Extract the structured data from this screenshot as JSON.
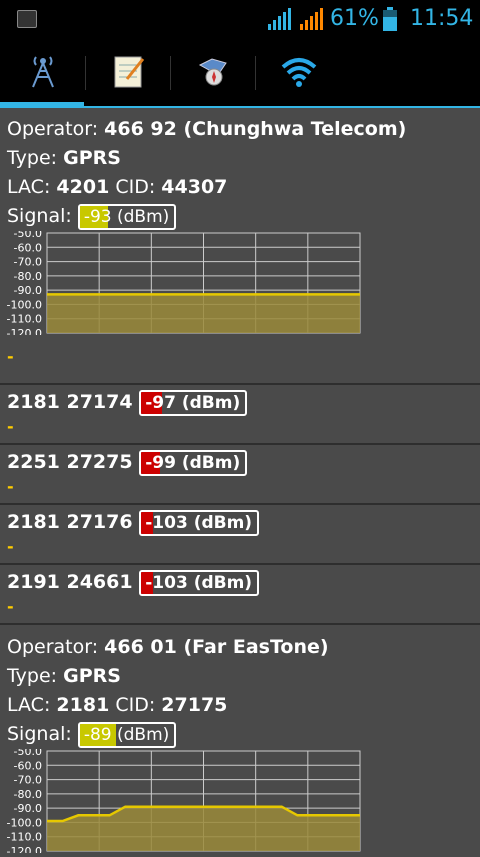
{
  "status": {
    "battery": "61%",
    "time": "11:54"
  },
  "tabs": [
    {
      "name": "tab-cell-towers",
      "icon": "antenna-tower-icon"
    },
    {
      "name": "tab-log",
      "icon": "notepad-icon"
    },
    {
      "name": "tab-map",
      "icon": "map-compass-icon"
    },
    {
      "name": "tab-wifi",
      "icon": "wifi-icon"
    }
  ],
  "op1": {
    "operator_label": "Operator: ",
    "operator": "466 92 (Chunghwa Telecom)",
    "type_label": "Type: ",
    "type": "GPRS",
    "lac_label": "LAC: ",
    "lac": "4201",
    "cid_label": " CID: ",
    "cid": "44307",
    "signal_label": "Signal: ",
    "signal": "-93",
    "unit": " (dBm)",
    "signal_level": 0.3,
    "signal_color": "#c8c800"
  },
  "neighbors": [
    {
      "id": "2181 27174",
      "signal": "-97",
      "unit": " (dBm)",
      "level": 0.2,
      "color": "#cc0000",
      "dash": "-"
    },
    {
      "id": "2251 27275",
      "signal": "-99",
      "unit": " (dBm)",
      "level": 0.18,
      "color": "#cc0000",
      "dash": "-"
    },
    {
      "id": "2181 27176",
      "signal": "-103",
      "unit": " (dBm)",
      "level": 0.1,
      "color": "#cc0000",
      "dash": "-"
    },
    {
      "id": "2191 24661",
      "signal": "-103",
      "unit": " (dBm)",
      "level": 0.1,
      "color": "#cc0000",
      "dash": "-"
    }
  ],
  "op1_dash": "-",
  "op2": {
    "operator_label": "Operator: ",
    "operator": "466 01 (Far EasTone)",
    "type_label": "Type: ",
    "type": "GPRS",
    "lac_label": "LAC: ",
    "lac": "2181",
    "cid_label": " CID: ",
    "cid": "27175",
    "signal_label": "Signal: ",
    "signal": "-89",
    "unit": " (dBm)",
    "signal_level": 0.38,
    "signal_color": "#c8c800"
  },
  "chart_data": [
    {
      "type": "area",
      "yticks": [
        "-50.0",
        "-60.0",
        "-70.0",
        "-80.0",
        "-90.0",
        "-100.0",
        "-110.0",
        "-120.0"
      ],
      "ylim": [
        -120,
        -50
      ],
      "x": [
        0,
        1,
        2,
        3,
        4,
        5,
        6,
        7,
        8,
        9,
        10,
        11,
        12,
        13,
        14,
        15,
        16,
        17,
        18,
        19,
        20
      ],
      "y": [
        -93,
        -93,
        -93,
        -93,
        -93,
        -93,
        -93,
        -93,
        -93,
        -93,
        -93,
        -93,
        -93,
        -93,
        -93,
        -93,
        -93,
        -93,
        -93,
        -93,
        -93
      ],
      "color": "#e6c800"
    },
    {
      "type": "area",
      "yticks": [
        "-50.0",
        "-60.0",
        "-70.0",
        "-80.0",
        "-90.0",
        "-100.0",
        "-110.0",
        "-120.0"
      ],
      "ylim": [
        -120,
        -50
      ],
      "x": [
        0,
        1,
        2,
        3,
        4,
        5,
        6,
        7,
        8,
        9,
        10,
        11,
        12,
        13,
        14,
        15,
        16,
        17,
        18,
        19,
        20
      ],
      "y": [
        -99,
        -99,
        -95,
        -95,
        -95,
        -89,
        -89,
        -89,
        -89,
        -89,
        -89,
        -89,
        -89,
        -89,
        -89,
        -89,
        -95,
        -95,
        -95,
        -95,
        -95
      ],
      "color": "#e6c800"
    }
  ]
}
